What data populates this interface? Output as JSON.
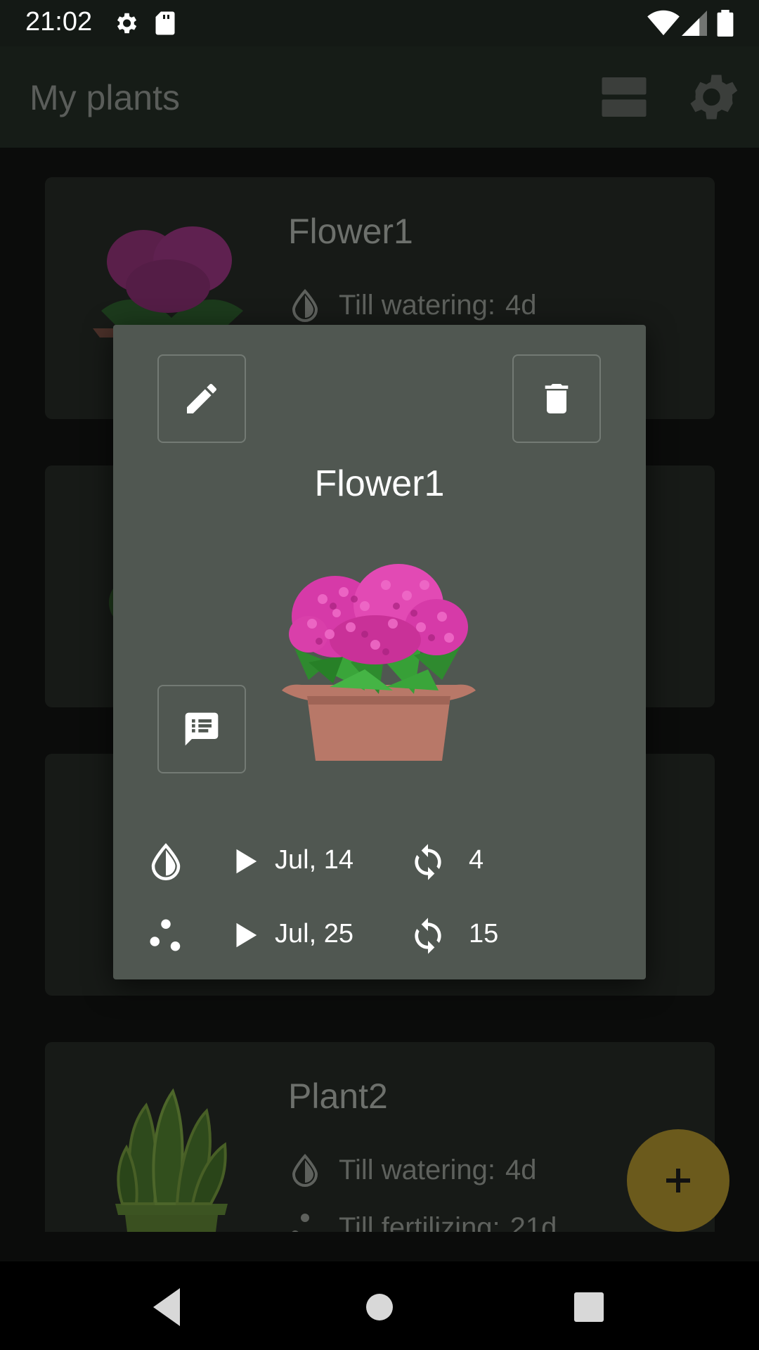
{
  "status_bar": {
    "time": "21:02",
    "icons": [
      "settings-icon",
      "sd-card-icon",
      "wifi-icon",
      "signal-icon",
      "battery-icon"
    ]
  },
  "app_bar": {
    "title": "My plants",
    "actions": [
      "view-toggle-icon",
      "settings-icon"
    ]
  },
  "plants": [
    {
      "name": "Flower1",
      "watering_label": "Till watering:",
      "watering_value": "4d"
    },
    {
      "name": "Plant2",
      "watering_label": "Till watering:",
      "watering_value": "4d",
      "fertilizing_label": "Till fertilizing:",
      "fertilizing_value": "21d"
    }
  ],
  "dialog": {
    "title": "Flower1",
    "watering": {
      "next_date": "Jul, 14",
      "interval": "4"
    },
    "fertilizing": {
      "next_date": "Jul, 25",
      "interval": "15"
    }
  },
  "colors": {
    "dialog_bg": "#505751",
    "fab": "#6b5a1c",
    "flower_pink": "#d63aa8",
    "pot": "#b87868"
  }
}
